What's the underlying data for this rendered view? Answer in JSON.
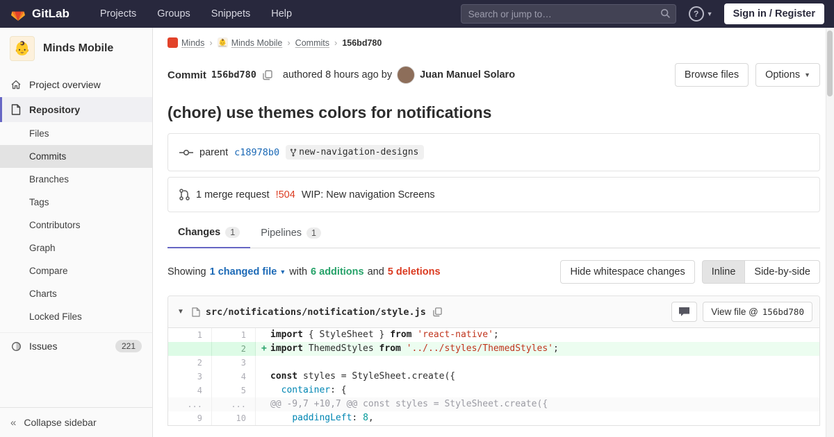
{
  "navbar": {
    "brand": "GitLab",
    "menu": [
      "Projects",
      "Groups",
      "Snippets",
      "Help"
    ],
    "search_placeholder": "Search or jump to…",
    "sign_in": "Sign in / Register"
  },
  "sidebar": {
    "project_name": "Minds Mobile",
    "project_avatar": "👶",
    "overview_label": "Project overview",
    "repository_label": "Repository",
    "repo_items": [
      "Files",
      "Commits",
      "Branches",
      "Tags",
      "Contributors",
      "Graph",
      "Compare",
      "Charts",
      "Locked Files"
    ],
    "active_repo_item": "Commits",
    "issues_label": "Issues",
    "issues_count": "221",
    "collapse_label": "Collapse sidebar"
  },
  "breadcrumb": {
    "group": "Minds",
    "project": "Minds Mobile",
    "section": "Commits",
    "current": "156bd780"
  },
  "commit": {
    "label": "Commit",
    "sha": "156bd780",
    "authored": "authored 8 hours ago by",
    "author": "Juan Manuel Solaro",
    "browse_files": "Browse files",
    "options": "Options",
    "title": "(chore) use themes colors for notifications",
    "parent_label": "parent",
    "parent_sha": "c18978b0",
    "branch": "new-navigation-designs",
    "mr_count_text": "1 merge request",
    "mr_ref": "!504",
    "mr_title": "WIP: New navigation Screens"
  },
  "tabs": [
    {
      "label": "Changes",
      "count": "1"
    },
    {
      "label": "Pipelines",
      "count": "1"
    }
  ],
  "changes_bar": {
    "showing": "Showing",
    "changed_file": "1 changed file",
    "with_text": "with",
    "additions": "6 additions",
    "and_text": "and",
    "deletions": "5 deletions",
    "hide_whitespace": "Hide whitespace changes",
    "inline": "Inline",
    "side_by_side": "Side-by-side"
  },
  "diff": {
    "file_path": "src/notifications/notification/style.js",
    "view_file_label": "View file @",
    "view_file_sha": "156bd780",
    "rows": [
      {
        "old": "1",
        "new": "1",
        "type": "context",
        "segments": [
          {
            "cls": "k",
            "text": "import"
          },
          {
            "cls": "c",
            "text": " { StyleSheet } "
          },
          {
            "cls": "k",
            "text": "from"
          },
          {
            "cls": "c",
            "text": " "
          },
          {
            "cls": "s",
            "text": "'react-native'"
          },
          {
            "cls": "c",
            "text": ";"
          }
        ]
      },
      {
        "old": "",
        "new": "2",
        "type": "add",
        "sign": "+",
        "segments": [
          {
            "cls": "k",
            "text": "import"
          },
          {
            "cls": "c",
            "text": " ThemedStyles "
          },
          {
            "cls": "k",
            "text": "from"
          },
          {
            "cls": "c",
            "text": " "
          },
          {
            "cls": "s",
            "text": "'../../styles/ThemedStyles'"
          },
          {
            "cls": "c",
            "text": ";"
          }
        ]
      },
      {
        "old": "2",
        "new": "3",
        "type": "context",
        "segments": []
      },
      {
        "old": "3",
        "new": "4",
        "type": "context",
        "segments": [
          {
            "cls": "k",
            "text": "const"
          },
          {
            "cls": "c",
            "text": " styles = StyleSheet.create({"
          }
        ]
      },
      {
        "old": "4",
        "new": "5",
        "type": "context",
        "segments": [
          {
            "cls": "c",
            "text": "  "
          },
          {
            "cls": "t",
            "text": "container"
          },
          {
            "cls": "c",
            "text": ": {"
          }
        ]
      },
      {
        "old": "...",
        "new": "...",
        "type": "match",
        "segments": [
          {
            "cls": "m",
            "text": "@@ -9,7 +10,7 @@ const styles = StyleSheet.create({"
          }
        ]
      },
      {
        "old": "9",
        "new": "10",
        "type": "context",
        "segments": [
          {
            "cls": "c",
            "text": "    "
          },
          {
            "cls": "t",
            "text": "paddingLeft"
          },
          {
            "cls": "c",
            "text": ": "
          },
          {
            "cls": "n",
            "text": "8"
          },
          {
            "cls": "c",
            "text": ","
          }
        ]
      }
    ]
  },
  "colors": {
    "navbar_bg": "#28283d",
    "accent": "#6666c4",
    "link_blue": "#1b69b6",
    "addition_green": "#26a269",
    "deletion_red": "#db3b21"
  }
}
